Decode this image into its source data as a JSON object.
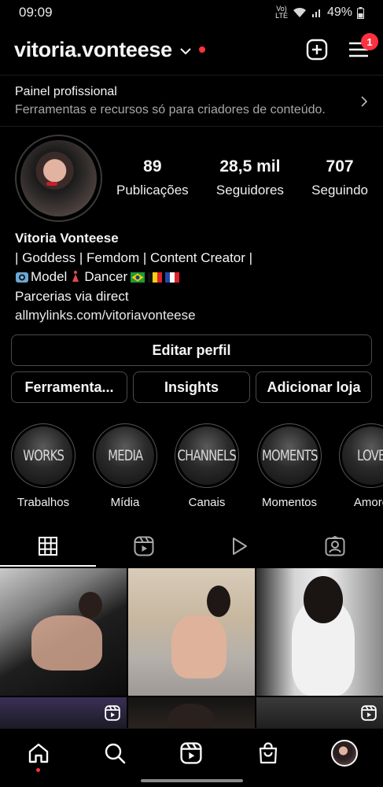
{
  "status_bar": {
    "time": "09:09",
    "network": "VoLTE",
    "battery": "49%"
  },
  "header": {
    "username": "vitoria.vonteese",
    "notifications_count": "1"
  },
  "pro_panel": {
    "title": "Painel profissional",
    "subtitle": "Ferramentas e recursos só para criadores de conteúdo."
  },
  "stats": {
    "posts": {
      "value": "89",
      "label": "Publicações"
    },
    "followers": {
      "value": "28,5 mil",
      "label": "Seguidores"
    },
    "following": {
      "value": "707",
      "label": "Seguindo"
    }
  },
  "bio": {
    "name": "Vitoria Vonteese",
    "line1": "| Goddess | Femdom | Content Creator |",
    "line2_model": "Model",
    "line2_dancer": "Dancer",
    "line3": "Parcerias via direct",
    "link": "allmylinks.com/vitoriavonteese"
  },
  "buttons": {
    "edit_profile": "Editar perfil",
    "tools": "Ferramenta...",
    "insights": "Insights",
    "add_shop": "Adicionar loja"
  },
  "highlights": [
    {
      "cover_text": "WORKS",
      "label": "Trabalhos"
    },
    {
      "cover_text": "MEDIA",
      "label": "Mídia"
    },
    {
      "cover_text": "CHANNELS",
      "label": "Canais"
    },
    {
      "cover_text": "MOMENTS",
      "label": "Momentos"
    },
    {
      "cover_text": "LOVE",
      "label": "Amore"
    }
  ],
  "tabs": [
    "grid-icon",
    "reels-icon",
    "play-icon",
    "tagged-icon"
  ],
  "colors": {
    "accent_red": "#ff3040",
    "background": "#000000",
    "muted_text": "#a8a8a8"
  }
}
